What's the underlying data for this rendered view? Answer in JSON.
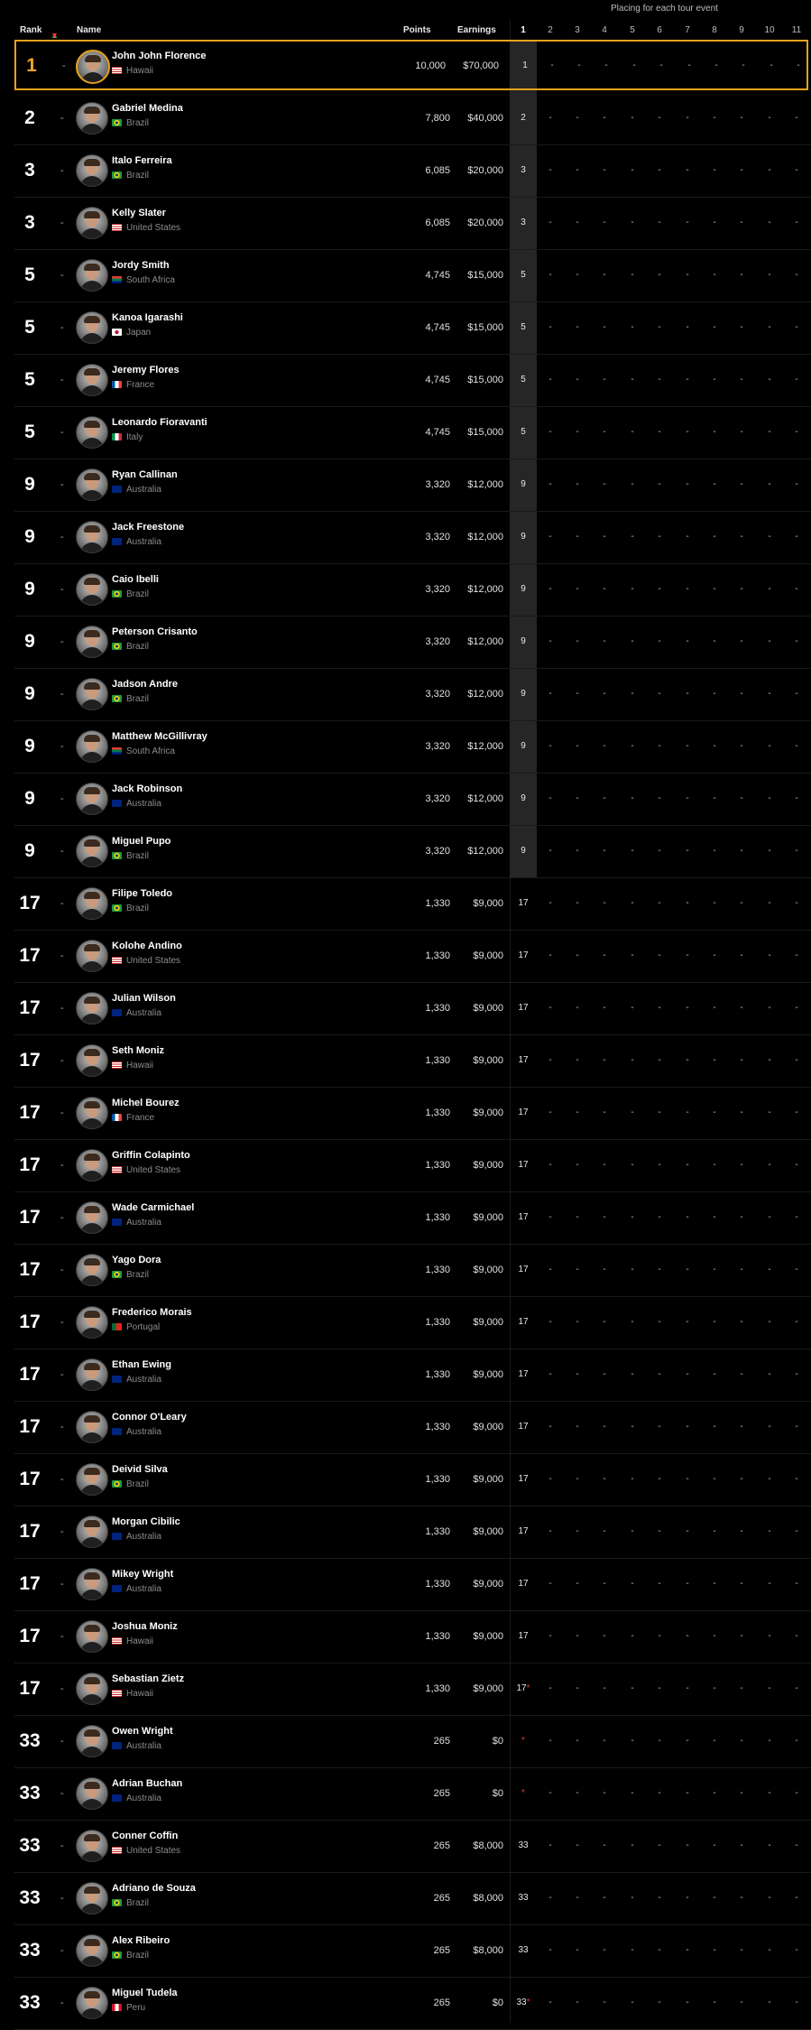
{
  "header": {
    "placing_caption": "Placing for each tour event",
    "rank": "Rank",
    "name": "Name",
    "points": "Points",
    "earnings": "Earnings",
    "arrow_up": "▲",
    "arrow_down": "▼",
    "events": [
      "1",
      "2",
      "3",
      "4",
      "5",
      "6",
      "7",
      "8",
      "9",
      "10",
      "11"
    ]
  },
  "colors": {
    "leader_border": "#e6a21c",
    "leader_rank": "#f0a423",
    "event1_highlight": "#262626",
    "star": "#e53935"
  },
  "rows": [
    {
      "rank": "1",
      "move": "-",
      "name": "John John Florence",
      "country": "Hawaii",
      "flag": "us",
      "points": "10,000",
      "earnings": "$70,000",
      "ev1": "1"
    },
    {
      "rank": "2",
      "move": "-",
      "name": "Gabriel Medina",
      "country": "Brazil",
      "flag": "br",
      "points": "7,800",
      "earnings": "$40,000",
      "ev1": "2"
    },
    {
      "rank": "3",
      "move": "-",
      "name": "Italo Ferreira",
      "country": "Brazil",
      "flag": "br",
      "points": "6,085",
      "earnings": "$20,000",
      "ev1": "3"
    },
    {
      "rank": "3",
      "move": "-",
      "name": "Kelly Slater",
      "country": "United States",
      "flag": "us",
      "points": "6,085",
      "earnings": "$20,000",
      "ev1": "3"
    },
    {
      "rank": "5",
      "move": "-",
      "name": "Jordy Smith",
      "country": "South Africa",
      "flag": "za",
      "points": "4,745",
      "earnings": "$15,000",
      "ev1": "5"
    },
    {
      "rank": "5",
      "move": "-",
      "name": "Kanoa Igarashi",
      "country": "Japan",
      "flag": "jp",
      "points": "4,745",
      "earnings": "$15,000",
      "ev1": "5"
    },
    {
      "rank": "5",
      "move": "-",
      "name": "Jeremy Flores",
      "country": "France",
      "flag": "fr",
      "points": "4,745",
      "earnings": "$15,000",
      "ev1": "5"
    },
    {
      "rank": "5",
      "move": "-",
      "name": "Leonardo Fioravanti",
      "country": "Italy",
      "flag": "it",
      "points": "4,745",
      "earnings": "$15,000",
      "ev1": "5"
    },
    {
      "rank": "9",
      "move": "-",
      "name": "Ryan Callinan",
      "country": "Australia",
      "flag": "au",
      "points": "3,320",
      "earnings": "$12,000",
      "ev1": "9"
    },
    {
      "rank": "9",
      "move": "-",
      "name": "Jack Freestone",
      "country": "Australia",
      "flag": "au",
      "points": "3,320",
      "earnings": "$12,000",
      "ev1": "9"
    },
    {
      "rank": "9",
      "move": "-",
      "name": "Caio Ibelli",
      "country": "Brazil",
      "flag": "br",
      "points": "3,320",
      "earnings": "$12,000",
      "ev1": "9"
    },
    {
      "rank": "9",
      "move": "-",
      "name": "Peterson Crisanto",
      "country": "Brazil",
      "flag": "br",
      "points": "3,320",
      "earnings": "$12,000",
      "ev1": "9"
    },
    {
      "rank": "9",
      "move": "-",
      "name": "Jadson Andre",
      "country": "Brazil",
      "flag": "br",
      "points": "3,320",
      "earnings": "$12,000",
      "ev1": "9"
    },
    {
      "rank": "9",
      "move": "-",
      "name": "Matthew McGillivray",
      "country": "South Africa",
      "flag": "za",
      "points": "3,320",
      "earnings": "$12,000",
      "ev1": "9"
    },
    {
      "rank": "9",
      "move": "-",
      "name": "Jack Robinson",
      "country": "Australia",
      "flag": "au",
      "points": "3,320",
      "earnings": "$12,000",
      "ev1": "9"
    },
    {
      "rank": "9",
      "move": "-",
      "name": "Miguel Pupo",
      "country": "Brazil",
      "flag": "br",
      "points": "3,320",
      "earnings": "$12,000",
      "ev1": "9"
    },
    {
      "rank": "17",
      "move": "-",
      "name": "Filipe Toledo",
      "country": "Brazil",
      "flag": "br",
      "points": "1,330",
      "earnings": "$9,000",
      "ev1": "17"
    },
    {
      "rank": "17",
      "move": "-",
      "name": "Kolohe Andino",
      "country": "United States",
      "flag": "us",
      "points": "1,330",
      "earnings": "$9,000",
      "ev1": "17"
    },
    {
      "rank": "17",
      "move": "-",
      "name": "Julian Wilson",
      "country": "Australia",
      "flag": "au",
      "points": "1,330",
      "earnings": "$9,000",
      "ev1": "17"
    },
    {
      "rank": "17",
      "move": "-",
      "name": "Seth Moniz",
      "country": "Hawaii",
      "flag": "us",
      "points": "1,330",
      "earnings": "$9,000",
      "ev1": "17"
    },
    {
      "rank": "17",
      "move": "-",
      "name": "Michel Bourez",
      "country": "France",
      "flag": "fr",
      "points": "1,330",
      "earnings": "$9,000",
      "ev1": "17"
    },
    {
      "rank": "17",
      "move": "-",
      "name": "Griffin Colapinto",
      "country": "United States",
      "flag": "us",
      "points": "1,330",
      "earnings": "$9,000",
      "ev1": "17"
    },
    {
      "rank": "17",
      "move": "-",
      "name": "Wade Carmichael",
      "country": "Australia",
      "flag": "au",
      "points": "1,330",
      "earnings": "$9,000",
      "ev1": "17"
    },
    {
      "rank": "17",
      "move": "-",
      "name": "Yago Dora",
      "country": "Brazil",
      "flag": "br",
      "points": "1,330",
      "earnings": "$9,000",
      "ev1": "17"
    },
    {
      "rank": "17",
      "move": "-",
      "name": "Frederico Morais",
      "country": "Portugal",
      "flag": "pt",
      "points": "1,330",
      "earnings": "$9,000",
      "ev1": "17"
    },
    {
      "rank": "17",
      "move": "-",
      "name": "Ethan Ewing",
      "country": "Australia",
      "flag": "au",
      "points": "1,330",
      "earnings": "$9,000",
      "ev1": "17"
    },
    {
      "rank": "17",
      "move": "-",
      "name": "Connor O'Leary",
      "country": "Australia",
      "flag": "au",
      "points": "1,330",
      "earnings": "$9,000",
      "ev1": "17"
    },
    {
      "rank": "17",
      "move": "-",
      "name": "Deivid Silva",
      "country": "Brazil",
      "flag": "br",
      "points": "1,330",
      "earnings": "$9,000",
      "ev1": "17"
    },
    {
      "rank": "17",
      "move": "-",
      "name": "Morgan Cibilic",
      "country": "Australia",
      "flag": "au",
      "points": "1,330",
      "earnings": "$9,000",
      "ev1": "17"
    },
    {
      "rank": "17",
      "move": "-",
      "name": "Mikey Wright",
      "country": "Australia",
      "flag": "au",
      "points": "1,330",
      "earnings": "$9,000",
      "ev1": "17"
    },
    {
      "rank": "17",
      "move": "-",
      "name": "Joshua Moniz",
      "country": "Hawaii",
      "flag": "us",
      "points": "1,330",
      "earnings": "$9,000",
      "ev1": "17"
    },
    {
      "rank": "17",
      "move": "-",
      "name": "Sebastian Zietz",
      "country": "Hawaii",
      "flag": "us",
      "points": "1,330",
      "earnings": "$9,000",
      "ev1": "17",
      "ev1_star": "*"
    },
    {
      "rank": "33",
      "move": "-",
      "name": "Owen Wright",
      "country": "Australia",
      "flag": "au",
      "points": "265",
      "earnings": "$0",
      "ev1": "",
      "ev1_star": "*"
    },
    {
      "rank": "33",
      "move": "-",
      "name": "Adrian Buchan",
      "country": "Australia",
      "flag": "au",
      "points": "265",
      "earnings": "$0",
      "ev1": "",
      "ev1_star": "*"
    },
    {
      "rank": "33",
      "move": "-",
      "name": "Conner Coffin",
      "country": "United States",
      "flag": "us",
      "points": "265",
      "earnings": "$8,000",
      "ev1": "33"
    },
    {
      "rank": "33",
      "move": "-",
      "name": "Adriano de Souza",
      "country": "Brazil",
      "flag": "br",
      "points": "265",
      "earnings": "$8,000",
      "ev1": "33"
    },
    {
      "rank": "33",
      "move": "-",
      "name": "Alex Ribeiro",
      "country": "Brazil",
      "flag": "br",
      "points": "265",
      "earnings": "$8,000",
      "ev1": "33"
    },
    {
      "rank": "33",
      "move": "-",
      "name": "Miguel Tudela",
      "country": "Peru",
      "flag": "pe",
      "points": "265",
      "earnings": "$0",
      "ev1": "33",
      "ev1_star": "*"
    }
  ],
  "empty_placing": "-"
}
